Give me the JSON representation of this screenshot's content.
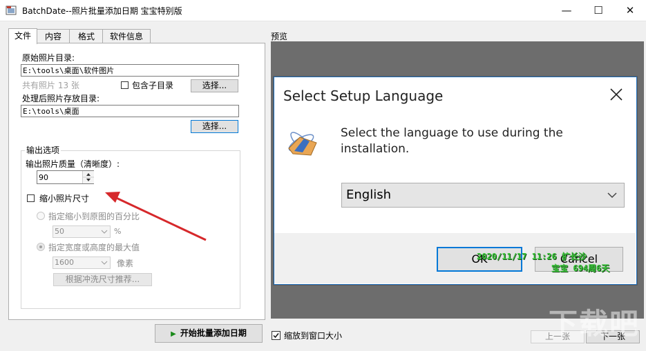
{
  "window": {
    "title": "BatchDate--照片批量添加日期 宝宝特别版",
    "minimize": "—",
    "maximize": "☐",
    "close": "✕"
  },
  "tabs": [
    {
      "label": "文件"
    },
    {
      "label": "内容"
    },
    {
      "label": "格式"
    },
    {
      "label": "软件信息"
    }
  ],
  "file_tab": {
    "source_label": "原始照片目录:",
    "source_value": "E:\\tools\\桌面\\软件图片",
    "photo_count": "共有照片 13 张",
    "include_subdirs_label": "包含子目录",
    "include_subdirs_checked": false,
    "browse_label": "选择...",
    "output_label": "处理后照片存放目录:",
    "output_value": "E:\\tools\\桌面",
    "output_browse_label": "选择..."
  },
  "output_options": {
    "group_label": "输出选项",
    "quality_label": "输出照片质量（清晰度）:",
    "quality_value": "90",
    "shrink_label": "缩小照片尺寸",
    "shrink_checked": false,
    "percent_label": "指定缩小到原图的百分比",
    "percent_value": "50",
    "percent_unit": "%",
    "maxsize_label": "指定宽度或高度的最大值",
    "maxsize_value": "1600",
    "maxsize_unit": "像素",
    "recommend_label": "根据冲洗尺寸推荐..."
  },
  "preview": {
    "label": "预览",
    "dialog_title": "Select Setup Language",
    "dialog_message_line1": "Select the language to use during the",
    "dialog_message_line2": "installation.",
    "language_value": "English",
    "ok_label": "OK",
    "cancel_label": "Cancel",
    "stamp_line1": "2020/11/17 11:26 扩长沙",
    "stamp_line2": "宝宝 694周6天"
  },
  "bottom": {
    "start_label": "开始批量添加日期",
    "fit_label": "缩放到窗口大小",
    "fit_checked": true,
    "prev_label": "上一张",
    "next_label": "下一张"
  },
  "annotation": {
    "arrow_color": "#d6282b"
  },
  "watermark": {
    "text": "下载吧"
  }
}
